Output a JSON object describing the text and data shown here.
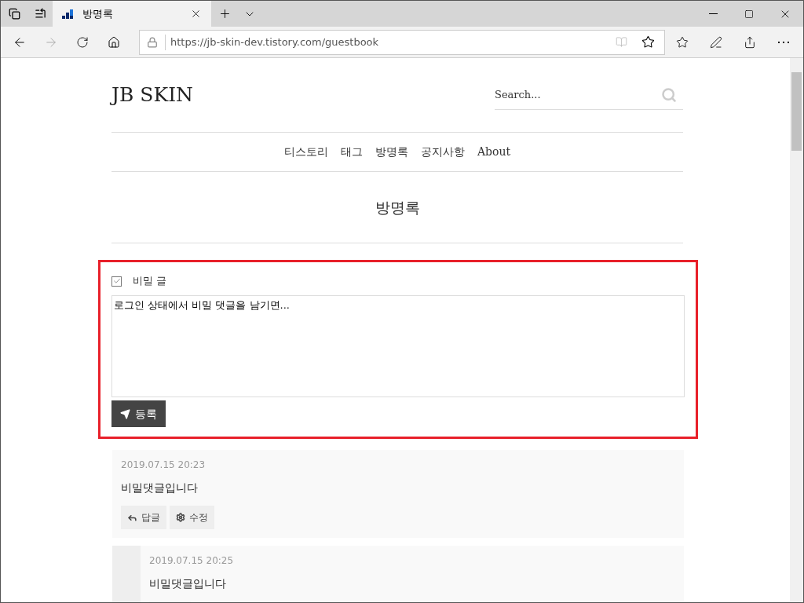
{
  "browser": {
    "tab": {
      "title": "방명록"
    },
    "url": "https://jb-skin-dev.tistory.com/guestbook"
  },
  "site": {
    "title": "JB SKIN",
    "search": {
      "placeholder": "Search..."
    },
    "nav": [
      "티스토리",
      "태그",
      "방명록",
      "공지사항",
      "About"
    ]
  },
  "page_title": "방명록",
  "form": {
    "secret": {
      "label": "비밀 글",
      "checked": true
    },
    "message": "로그인 상태에서 비밀 댓글을 남기면...",
    "submit": "등록"
  },
  "comments": [
    {
      "date": "2019.07.15 20:23",
      "text": "비밀댓글입니다",
      "actions": [
        {
          "kind": "reply",
          "label": "답글"
        },
        {
          "kind": "edit",
          "label": "수정"
        }
      ],
      "children": [
        {
          "date": "2019.07.15 20:25",
          "text": "비밀댓글입니다"
        }
      ]
    }
  ]
}
